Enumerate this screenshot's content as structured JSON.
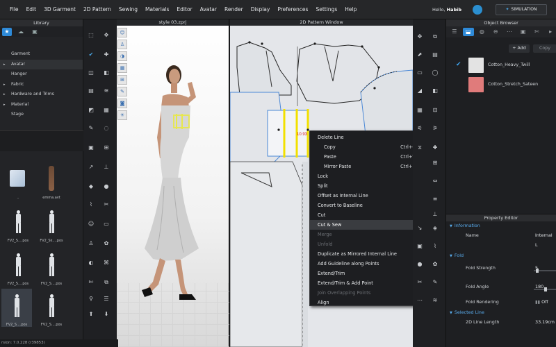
{
  "menubar": {
    "items": [
      "File",
      "Edit",
      "3D Garment",
      "2D Pattern",
      "Sewing",
      "Materials",
      "Editor",
      "Avatar",
      "Render",
      "Display",
      "Preferences",
      "Settings",
      "Help"
    ],
    "greeting_prefix": "Hello,",
    "user": "Habib",
    "simulation_label": "SIMULATION"
  },
  "library": {
    "title": "Library",
    "tree": [
      {
        "label": "Garment",
        "arrow": ""
      },
      {
        "label": "Avatar",
        "arrow": "▸",
        "selected": true
      },
      {
        "label": "Hanger",
        "arrow": ""
      },
      {
        "label": "Fabric",
        "arrow": "▸"
      },
      {
        "label": "Hardware and Trims",
        "arrow": "▸"
      },
      {
        "label": "Material",
        "arrow": "▸"
      },
      {
        "label": "Stage",
        "arrow": ""
      }
    ],
    "grid": [
      "..",
      "emma.avt",
      "FV2_S....pos",
      "FV2_Sk....pos",
      "FV2_S....pos",
      "FV2_S....pos",
      "FV2_S....pos",
      "FV2_S....pos"
    ]
  },
  "window3d": {
    "title": "style 03.zprj"
  },
  "window2d": {
    "title": "2D Pattern Window",
    "measure": "10.93"
  },
  "context_menu": {
    "items": [
      {
        "label": "Delete Line",
        "shortcut": "",
        "state": "normal",
        "indent": false,
        "submenu": false
      },
      {
        "label": "Copy",
        "shortcut": "Ctrl+C",
        "state": "normal",
        "indent": true,
        "submenu": false
      },
      {
        "label": "Paste",
        "shortcut": "Ctrl+V",
        "state": "normal",
        "indent": true,
        "submenu": false
      },
      {
        "label": "Mirror Paste",
        "shortcut": "Ctrl+R",
        "state": "normal",
        "indent": true,
        "submenu": false
      },
      {
        "label": "Lock",
        "shortcut": "",
        "state": "normal",
        "indent": false,
        "submenu": false
      },
      {
        "label": "Split",
        "shortcut": "",
        "state": "normal",
        "indent": false,
        "submenu": false
      },
      {
        "label": "Offset as Internal Line",
        "shortcut": "",
        "state": "normal",
        "indent": false,
        "submenu": false
      },
      {
        "label": "Convert to Baseline",
        "shortcut": "",
        "state": "normal",
        "indent": false,
        "submenu": false
      },
      {
        "label": "Cut",
        "shortcut": "",
        "state": "normal",
        "indent": false,
        "submenu": false
      },
      {
        "label": "Cut & Sew",
        "shortcut": "",
        "state": "highlighted",
        "indent": false,
        "submenu": false
      },
      {
        "label": "Merge",
        "shortcut": "",
        "state": "disabled",
        "indent": false,
        "submenu": false
      },
      {
        "label": "Unfold",
        "shortcut": "",
        "state": "disabled",
        "indent": false,
        "submenu": false
      },
      {
        "label": "Duplicate as Mirrored Internal Line",
        "shortcut": "",
        "state": "normal",
        "indent": false,
        "submenu": false
      },
      {
        "label": "Add Guideline along Points",
        "shortcut": "",
        "state": "normal",
        "indent": false,
        "submenu": false
      },
      {
        "label": "Extend/Trim",
        "shortcut": "",
        "state": "normal",
        "indent": false,
        "submenu": true
      },
      {
        "label": "Extend/Trim & Add Point",
        "shortcut": "",
        "state": "normal",
        "indent": false,
        "submenu": true
      },
      {
        "label": "Join Overlapping Points",
        "shortcut": "",
        "state": "disabled",
        "indent": false,
        "submenu": false
      },
      {
        "label": "Align",
        "shortcut": "",
        "state": "normal",
        "indent": false,
        "submenu": true
      }
    ]
  },
  "object_browser": {
    "title": "Object Browser",
    "add_label": "+ Add",
    "copy_label": "Copy",
    "fabrics": [
      {
        "name": "Cotton_Heavy_Twill",
        "color": "#e3e3e3",
        "checked": true
      },
      {
        "name": "Cotton_Stretch_Sateen",
        "color": "#e07b7b",
        "checked": false
      }
    ]
  },
  "property_editor": {
    "title": "Property Editor",
    "information_label": "Information",
    "name_label": "Name",
    "name_value": "Internal L",
    "fold_label": "Fold",
    "fold_strength_label": "Fold Strength",
    "fold_strength_value": "5",
    "fold_angle_label": "Fold Angle",
    "fold_angle_value": "180",
    "fold_rendering_label": "Fold Rendering",
    "fold_rendering_value": "Off",
    "selected_line_label": "Selected Line",
    "line_length_label": "2D Line Length",
    "line_length_value": "33.19cm"
  },
  "status": {
    "version": "rsion: 7.0.228 (r39853)"
  }
}
